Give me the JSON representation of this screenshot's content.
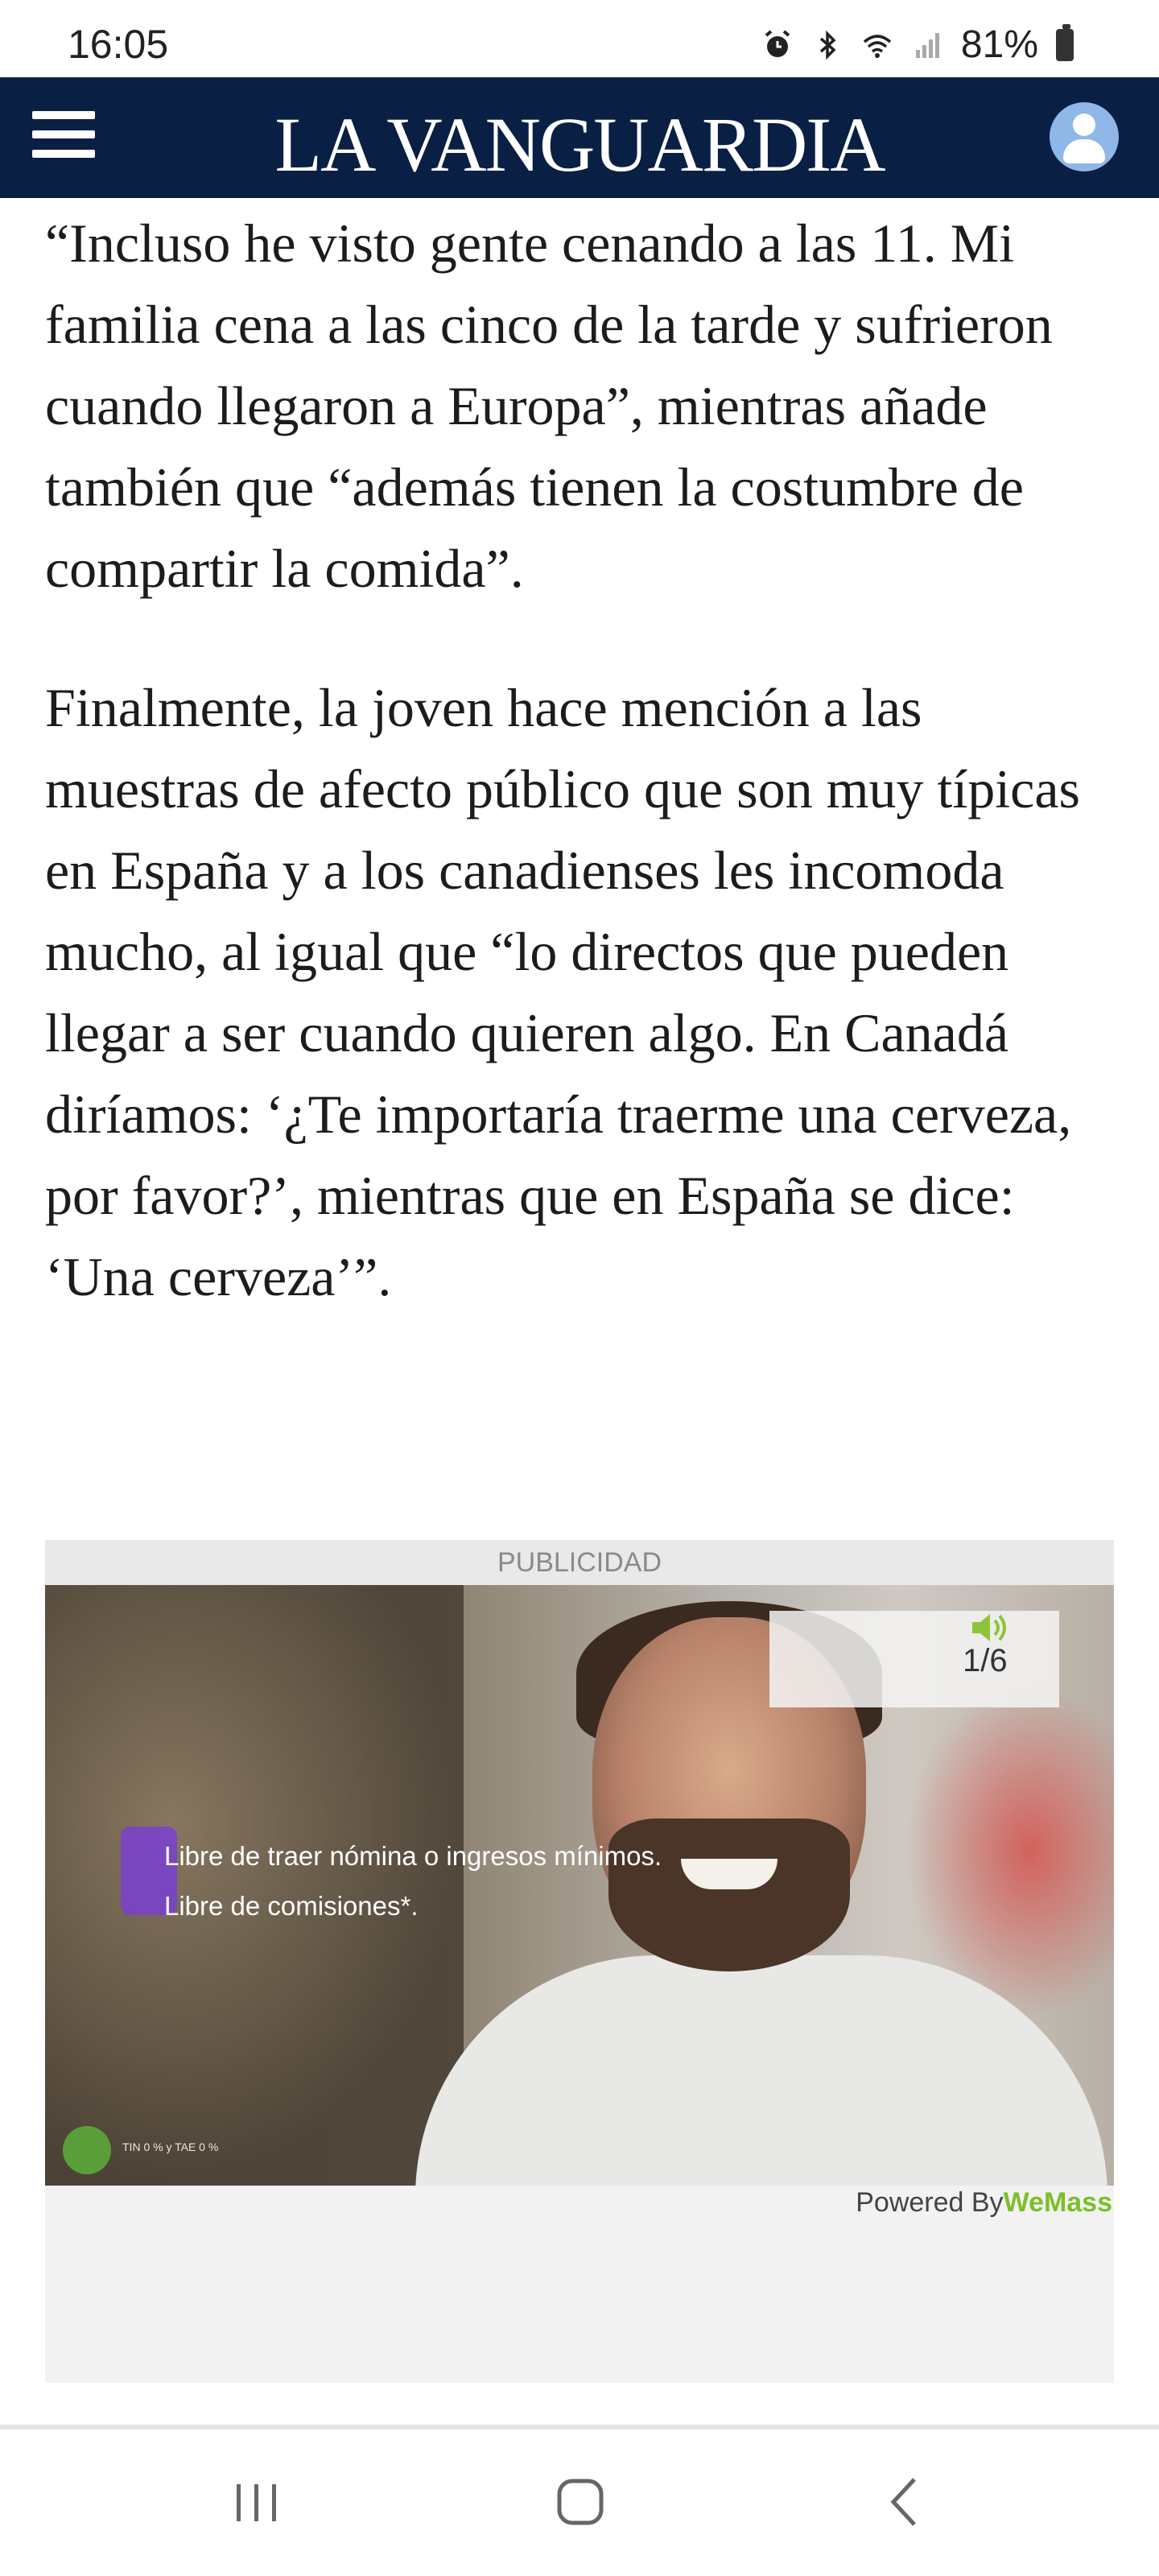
{
  "status_bar": {
    "time": "16:05",
    "battery": "81%",
    "icons": [
      "alarm-icon",
      "bluetooth-icon",
      "wifi-icon",
      "signal-icon",
      "battery-icon"
    ]
  },
  "header": {
    "brand": "LA VANGUARDIA",
    "menu_icon": "hamburger-icon",
    "user_icon": "user-icon",
    "background": "#0a1f44"
  },
  "article": {
    "paragraphs": [
      "“Incluso he visto gente cenando a las 11. Mi familia cena a las cinco de la tarde y sufrieron cuando llegaron a Europa”, mientras añade también que “además tienen la costumbre de compartir la comida”.",
      "Finalmente, la joven hace mención a las muestras de afecto público que son muy típicas en España y a los canadienses les incomoda mucho, al igual que “lo directos que pueden llegar a ser cuando quieren algo. En Canadá diríamos: ‘¿Te importaría traerme una cerveza, por favor?’, mientras que en España se dice: ‘Una cerveza’”."
    ]
  },
  "ad": {
    "label": "PUBLICIDAD",
    "line1": "Libre de traer nómina o ingresos mínimos.",
    "line2": "Libre de comisiones*.",
    "counter": "1/6",
    "legal": "TIN 0 % y TAE 0 %",
    "powered_prefix": "Powered By",
    "powered_brand": "WeMass",
    "brand_color": "#7cbf2a"
  },
  "nav_bar": {
    "buttons": [
      "recent-apps-icon",
      "home-icon",
      "back-icon"
    ]
  }
}
